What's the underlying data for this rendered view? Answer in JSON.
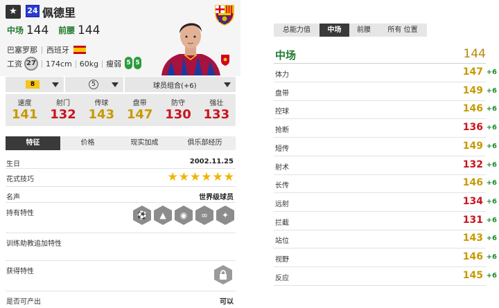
{
  "colors": {
    "gold": "#c79a00",
    "red": "#c8141e",
    "green": "#1f7a2e",
    "dark": "#3a3a3a"
  },
  "player": {
    "star_icon": "★",
    "season": "24",
    "name": "佩德里",
    "pos1": "中场",
    "ovr1": "144",
    "pos2": "前腰",
    "ovr2": "144",
    "club": "巴塞罗那",
    "nation": "西班牙",
    "wage_label": "工资",
    "wage": "27",
    "height": "174cm",
    "weight": "60kg",
    "body": "瘦弱",
    "left_foot": "5",
    "right_foot": "5"
  },
  "controls": {
    "enhance": "8",
    "level": "5",
    "combo": "球员组合(+6)"
  },
  "stats6": [
    {
      "label": "速度",
      "value": "141",
      "color": "gold"
    },
    {
      "label": "射门",
      "value": "132",
      "color": "red"
    },
    {
      "label": "传球",
      "value": "143",
      "color": "gold"
    },
    {
      "label": "盘带",
      "value": "147",
      "color": "gold"
    },
    {
      "label": "防守",
      "value": "130",
      "color": "red"
    },
    {
      "label": "强壮",
      "value": "133",
      "color": "red"
    }
  ],
  "tabs": [
    "特征",
    "价格",
    "现实加成",
    "俱乐部经历"
  ],
  "details": {
    "birthday_label": "生日",
    "birthday": "2002.11.25",
    "skill_label": "花式技巧",
    "skill_stars": 6,
    "fame_label": "名声",
    "fame": "世界级球员",
    "traits_label": "持有特性",
    "traits_icons": [
      "dribble-trait-icon",
      "long-shot-trait-icon",
      "playmaker-trait-icon",
      "passing-trait-icon",
      "flair-trait-icon"
    ],
    "coach_label": "训练助教追加特性",
    "acquired_label": "获得特性",
    "produce_label": "是否可产出",
    "produce": "可以"
  },
  "right_tabs": [
    "总能力值",
    "中场",
    "前腰",
    "所有 位置"
  ],
  "position_header": {
    "label": "中场",
    "value": "144"
  },
  "attributes": [
    {
      "label": "体力",
      "value": "147",
      "bonus": "+6",
      "color": "gold"
    },
    {
      "label": "盘带",
      "value": "149",
      "bonus": "+6",
      "color": "gold"
    },
    {
      "label": "控球",
      "value": "146",
      "bonus": "+6",
      "color": "gold"
    },
    {
      "label": "抢断",
      "value": "136",
      "bonus": "+6",
      "color": "red"
    },
    {
      "label": "短传",
      "value": "149",
      "bonus": "+6",
      "color": "gold"
    },
    {
      "label": "射术",
      "value": "132",
      "bonus": "+6",
      "color": "red"
    },
    {
      "label": "长传",
      "value": "146",
      "bonus": "+6",
      "color": "gold"
    },
    {
      "label": "远射",
      "value": "134",
      "bonus": "+6",
      "color": "red"
    },
    {
      "label": "拦截",
      "value": "131",
      "bonus": "+6",
      "color": "red"
    },
    {
      "label": "站位",
      "value": "143",
      "bonus": "+6",
      "color": "gold"
    },
    {
      "label": "视野",
      "value": "146",
      "bonus": "+6",
      "color": "gold"
    },
    {
      "label": "反应",
      "value": "145",
      "bonus": "+6",
      "color": "gold"
    }
  ]
}
